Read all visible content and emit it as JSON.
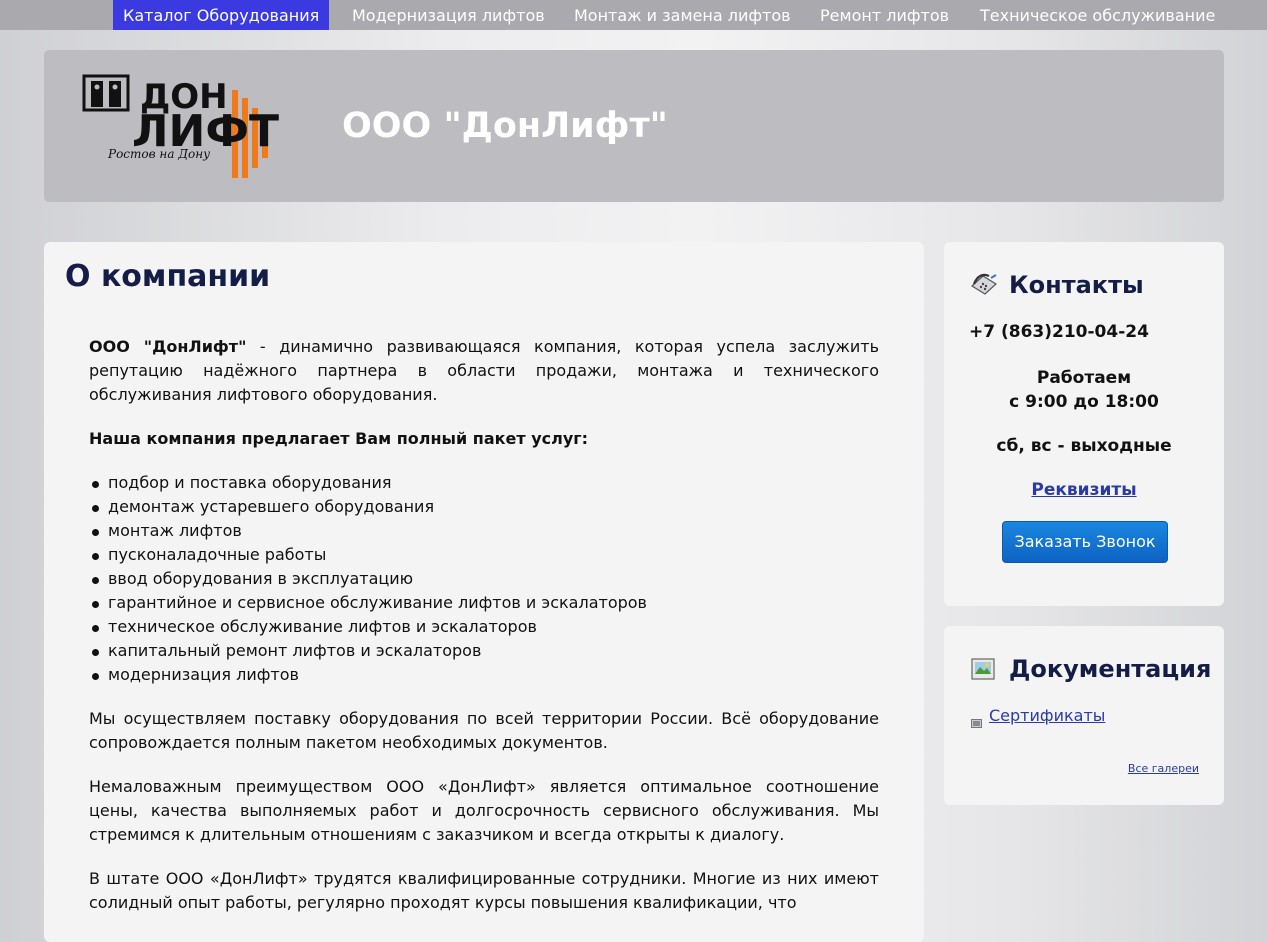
{
  "nav": {
    "items": [
      {
        "label": "Каталог Оборудования",
        "active": true
      },
      {
        "label": "Модернизация лифтов",
        "active": false
      },
      {
        "label": "Монтаж и замена лифтов",
        "active": false
      },
      {
        "label": "Ремонт лифтов",
        "active": false
      },
      {
        "label": "Техническое обслуживание",
        "active": false
      }
    ],
    "active_color": "#3a3ae0",
    "bar_color": "#a9a9ae"
  },
  "header": {
    "logo": {
      "line1": "ДОН",
      "line2": "ЛИФТ",
      "tagline": "Ростов на Дону",
      "icon": "elevator-doors-icon",
      "accent_color": "#f07a1a"
    },
    "title": "ООО \"ДонЛифт\""
  },
  "main": {
    "title": "О компании",
    "intro_bold": "ООО \"ДонЛифт\"",
    "intro_rest": " - динамично развивающаяся компания, которая успела заслужить репутацию надёжного партнера в области продажи, монтажа и технического обслуживания лифтового оборудования.",
    "services_heading": "Наша компания предлагает Вам полный пакет услуг:",
    "services": [
      "подбор и поставка оборудования",
      "демонтаж устаревшего оборудования",
      "монтаж лифтов",
      "пусконаладочные работы",
      "ввод оборудования в эксплуатацию",
      "гарантийное и сервисное обслуживание лифтов и эскалаторов",
      "техническое обслуживание лифтов и эскалаторов",
      "капитальный ремонт лифтов и эскалаторов",
      "модернизация лифтов"
    ],
    "para2": "Мы осуществляем поставку оборудования по всей территории России. Всё оборудование сопровождается полным пакетом необходимых документов.",
    "para3": "Немаловажным преимуществом ООО «ДонЛифт» является оптимальное соотношение цены, качества выполняемых работ и долгосрочность сервисного обслуживания. Мы стремимся к длительным отношениям с заказчиком и всегда открыты к диалогу.",
    "para4": "В штате ООО «ДонЛифт» трудятся квалифицированные сотрудники. Многие из них имеют солидный опыт работы, регулярно проходят курсы повышения квалификации, что"
  },
  "contacts": {
    "title": "Контакты",
    "icon": "phone-icon",
    "phone": "+7 (863)210-04-24",
    "hours_line1": "Работаем",
    "hours_line2": "с 9:00 до 18:00",
    "weekend": "сб, вс - выходные",
    "requisites_link": "Реквизиты",
    "call_button": "Заказать Звонок"
  },
  "docs": {
    "title": "Документация",
    "icon": "gallery-icon",
    "certificates_link": "Сертификаты",
    "all_galleries_link": "Все галереи"
  }
}
